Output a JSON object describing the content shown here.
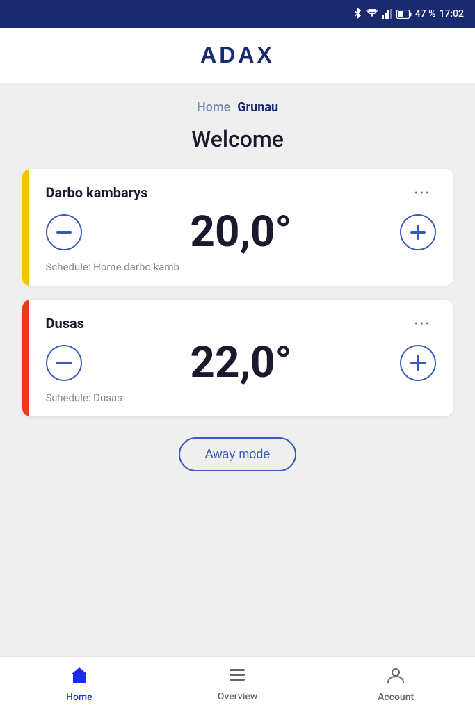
{
  "statusBar": {
    "battery": "47 %",
    "time": "17:02"
  },
  "header": {
    "logo": "ADAX"
  },
  "breadcrumb": {
    "home": "Home",
    "current": "Grunau"
  },
  "welcome": "Welcome",
  "cards": [
    {
      "id": "darbo-kambarys",
      "name": "Darbo kambarys",
      "temperature": "20,0°",
      "schedule": "Schedule: Home darbo kamb",
      "barColor": "bar-yellow",
      "moreLabel": "···"
    },
    {
      "id": "dusas",
      "name": "Dusas",
      "temperature": "22,0°",
      "schedule": "Schedule: Dusas",
      "barColor": "bar-orange",
      "moreLabel": "···"
    }
  ],
  "awayMode": {
    "label": "Away mode"
  },
  "bottomNav": [
    {
      "id": "home",
      "label": "Home",
      "active": true
    },
    {
      "id": "overview",
      "label": "Overview",
      "active": false
    },
    {
      "id": "account",
      "label": "Account",
      "active": false
    }
  ]
}
